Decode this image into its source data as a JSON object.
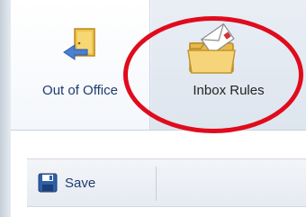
{
  "ribbon": {
    "out_of_office_label": "Out of Office",
    "inbox_rules_label": "Inbox Rules"
  },
  "toolbar": {
    "save_label": "Save"
  },
  "icons": {
    "out_of_office": "door-with-arrow-icon",
    "inbox_rules": "folder-with-envelope-icon",
    "save": "floppy-disk-icon"
  },
  "colors": {
    "highlight_circle": "#e00b1c",
    "link_text": "#1f3b73"
  }
}
